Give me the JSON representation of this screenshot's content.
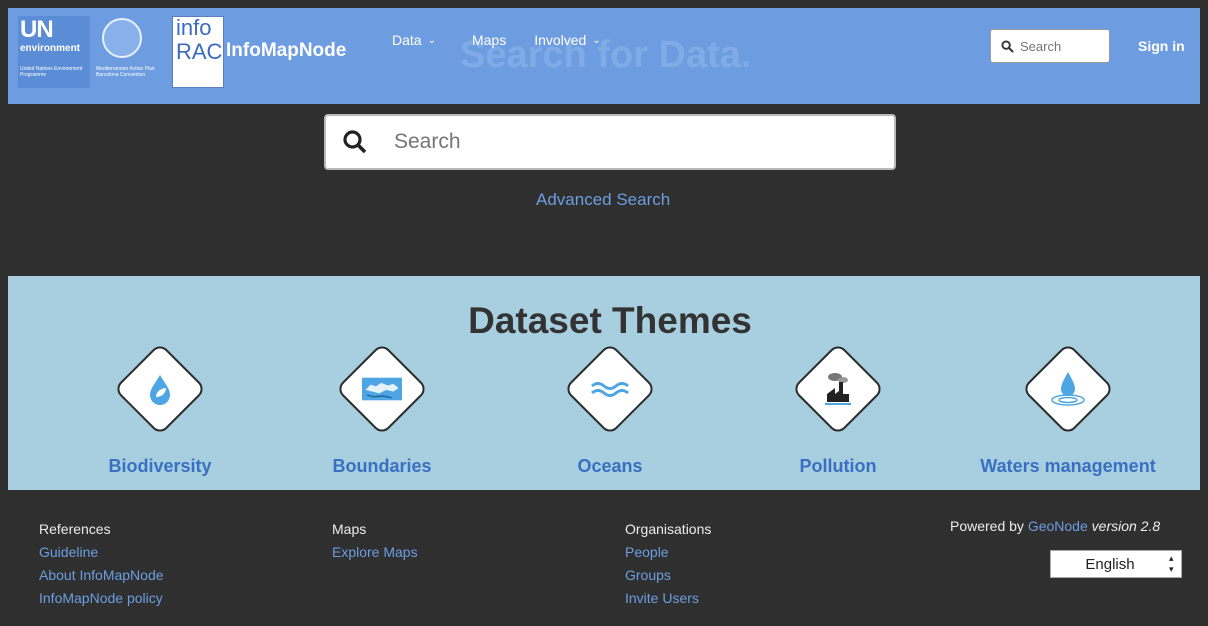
{
  "brand": {
    "un_text": "UN",
    "environment_text": "environment",
    "un_small": "United Nations Environment Programme",
    "map_small": "Mediterranean Action Plan Barcelona Convention",
    "info_top": "info",
    "info_bottom": "RAC",
    "name": "InfoMapNode"
  },
  "nav": {
    "items": [
      {
        "label": "Data",
        "caret": "⌄"
      },
      {
        "label": "Maps"
      },
      {
        "label": "Involved",
        "caret": "⌄"
      }
    ],
    "search_placeholder": "Search",
    "sign_in": "Sign in"
  },
  "hero": {
    "title": "Search for Data.",
    "search_placeholder": "Search",
    "advanced_search": "Advanced Search"
  },
  "themes": {
    "title": "Dataset Themes",
    "items": [
      {
        "label": "Biodiversity",
        "icon": "leaf-drop-icon"
      },
      {
        "label": "Boundaries",
        "icon": "map-icon"
      },
      {
        "label": "Oceans",
        "icon": "waves-icon"
      },
      {
        "label": "Pollution",
        "icon": "factory-icon"
      },
      {
        "label": "Waters management",
        "icon": "water-drop-icon"
      }
    ]
  },
  "footer": {
    "col1": {
      "head": "References",
      "links": [
        "Guideline",
        "About InfoMapNode",
        "InfoMapNode policy"
      ]
    },
    "col2": {
      "head": "Maps",
      "links": [
        "Explore Maps"
      ]
    },
    "col3": {
      "head": "Organisations",
      "links": [
        "People",
        "Groups",
        "Invite Users"
      ]
    },
    "powered_prefix": "Powered by",
    "powered_link": "GeoNode",
    "powered_version": "version 2.8",
    "language": "English"
  },
  "colors": {
    "navbar": "#6d9de0",
    "dark": "#2f2f2f",
    "themes_bg": "#a7cfe0",
    "link": "#6d9de0",
    "theme_label": "#3a6fc2"
  }
}
